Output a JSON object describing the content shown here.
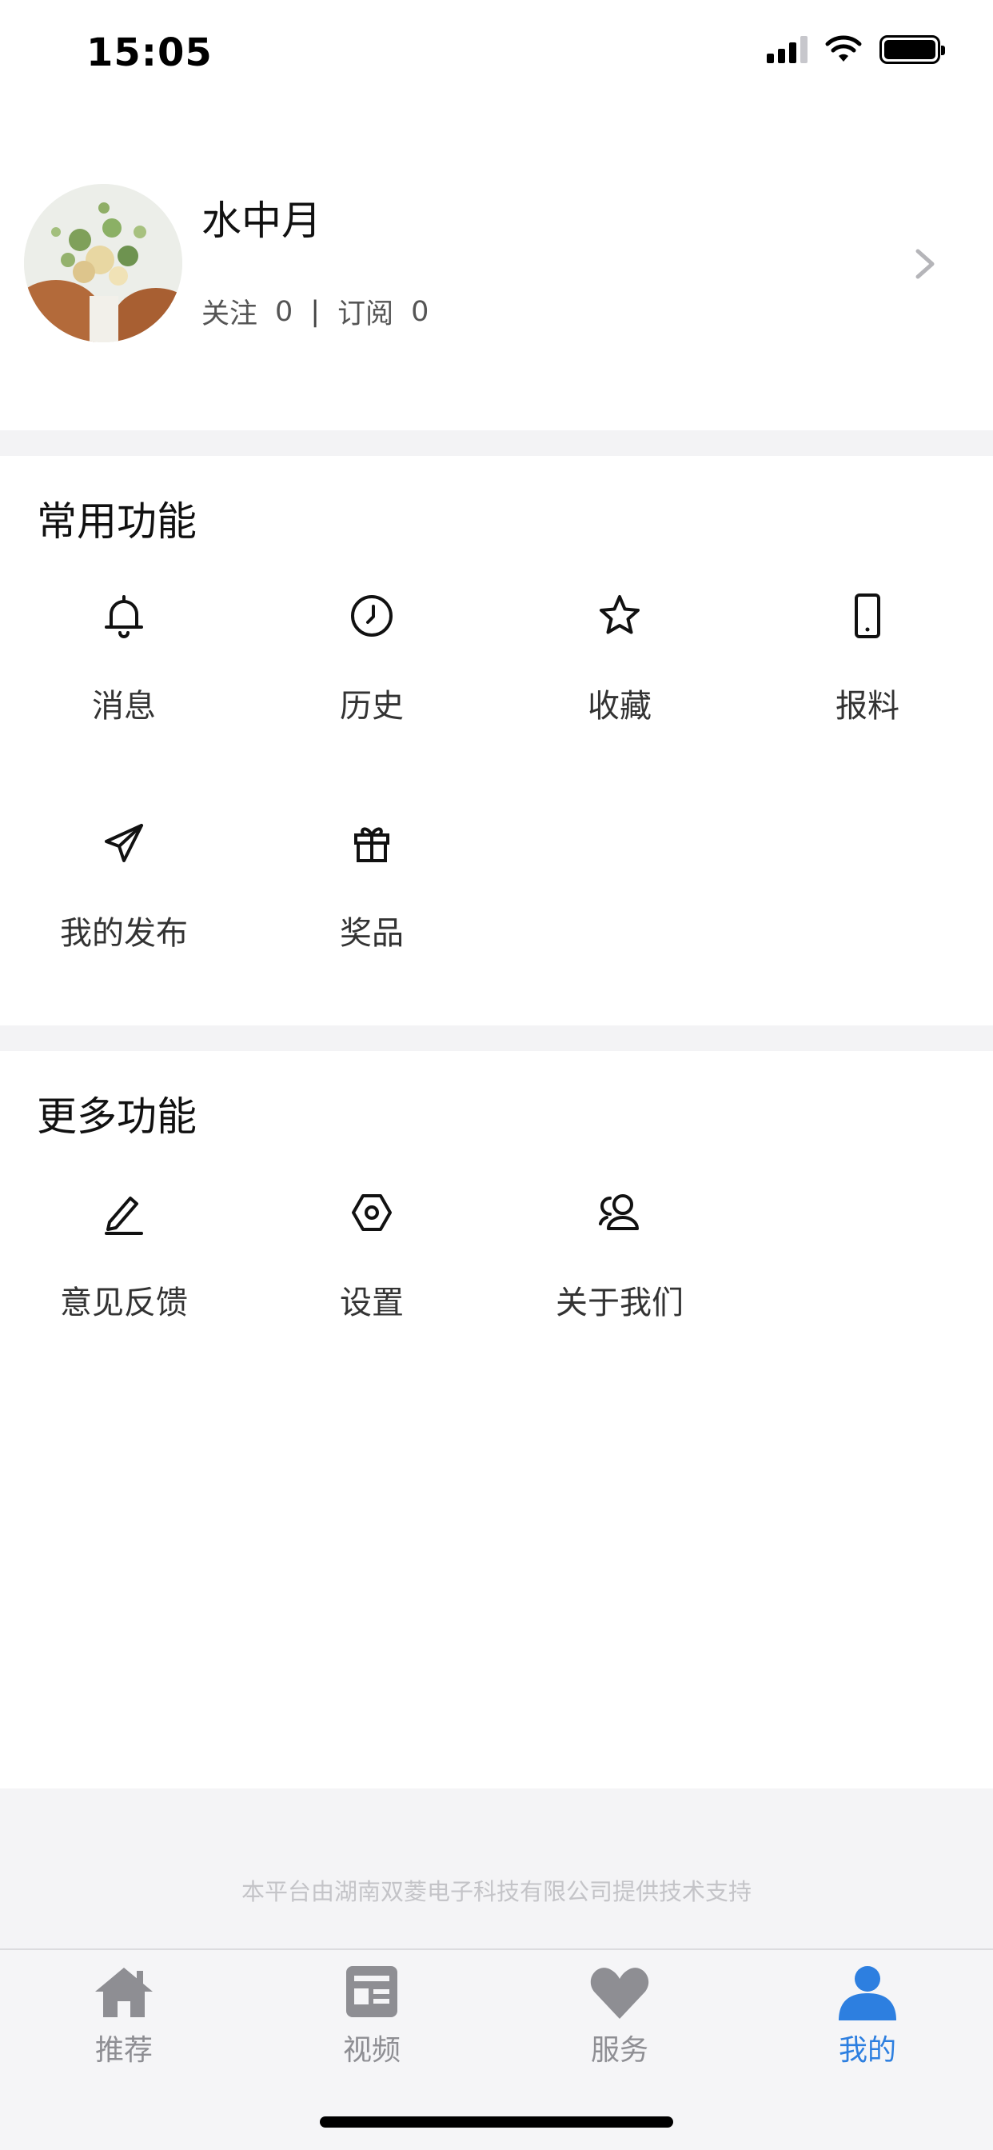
{
  "status_bar": {
    "time": "15:05"
  },
  "profile": {
    "name": "水中月",
    "follow_label": "关注",
    "follow_count": "0",
    "separator": "|",
    "subscribe_label": "订阅",
    "subscribe_count": "0"
  },
  "common_section": {
    "title": "常用功能",
    "items": [
      {
        "label": "消息",
        "icon": "bell-icon"
      },
      {
        "label": "历史",
        "icon": "clock-icon"
      },
      {
        "label": "收藏",
        "icon": "star-icon"
      },
      {
        "label": "报料",
        "icon": "phone-icon"
      },
      {
        "label": "我的发布",
        "icon": "paper-plane-icon"
      },
      {
        "label": "奖品",
        "icon": "gift-icon"
      }
    ]
  },
  "more_section": {
    "title": "更多功能",
    "items": [
      {
        "label": "意见反馈",
        "icon": "pencil-icon"
      },
      {
        "label": "设置",
        "icon": "hex-gear-icon"
      },
      {
        "label": "关于我们",
        "icon": "users-icon"
      }
    ]
  },
  "footer": {
    "text": "本平台由湖南双菱电子科技有限公司提供技术支持"
  },
  "tabbar": {
    "tabs": [
      {
        "label": "推荐",
        "icon": "home-icon"
      },
      {
        "label": "视频",
        "icon": "news-icon"
      },
      {
        "label": "服务",
        "icon": "heart-icon"
      },
      {
        "label": "我的",
        "icon": "person-icon",
        "active": true
      }
    ]
  },
  "colors": {
    "accent": "#2d7fe0",
    "inactive": "#8e8e93",
    "band": "#f3f3f5"
  }
}
